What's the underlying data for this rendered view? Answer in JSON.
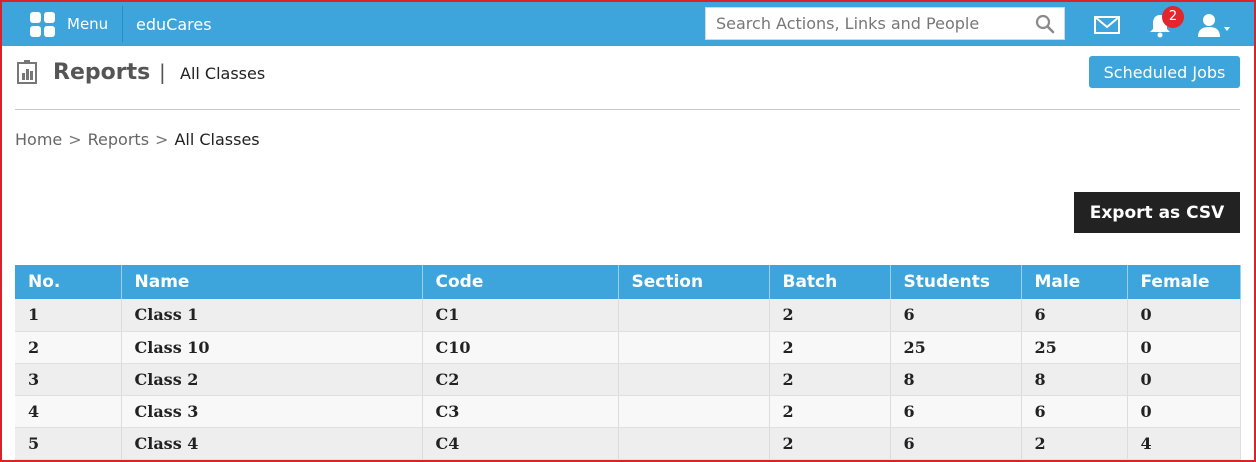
{
  "topbar": {
    "menu_label": "Menu",
    "brand": "eduCares",
    "search_placeholder": "Search Actions, Links and People",
    "notification_count": "2",
    "accent_color": "#3da5db",
    "icons": [
      "grid-menu-icon",
      "search-icon",
      "mail-icon",
      "bell-icon",
      "user-icon"
    ]
  },
  "header": {
    "title": "Reports",
    "separator": "|",
    "subtitle": "All Classes",
    "scheduled_jobs_label": "Scheduled Jobs"
  },
  "breadcrumb": {
    "items": [
      "Home",
      "Reports",
      "All Classes"
    ],
    "separator": ">"
  },
  "actions": {
    "export_label": "Export as CSV"
  },
  "table": {
    "columns": [
      "No.",
      "Name",
      "Code",
      "Section",
      "Batch",
      "Students",
      "Male",
      "Female"
    ],
    "rows": [
      [
        "1",
        "Class 1",
        "C1",
        "",
        "2",
        "6",
        "6",
        "0"
      ],
      [
        "2",
        "Class 10",
        "C10",
        "",
        "2",
        "25",
        "25",
        "0"
      ],
      [
        "3",
        "Class 2",
        "C2",
        "",
        "2",
        "8",
        "8",
        "0"
      ],
      [
        "4",
        "Class 3",
        "C3",
        "",
        "2",
        "6",
        "6",
        "0"
      ],
      [
        "5",
        "Class 4",
        "C4",
        "",
        "2",
        "6",
        "2",
        "4"
      ]
    ]
  }
}
